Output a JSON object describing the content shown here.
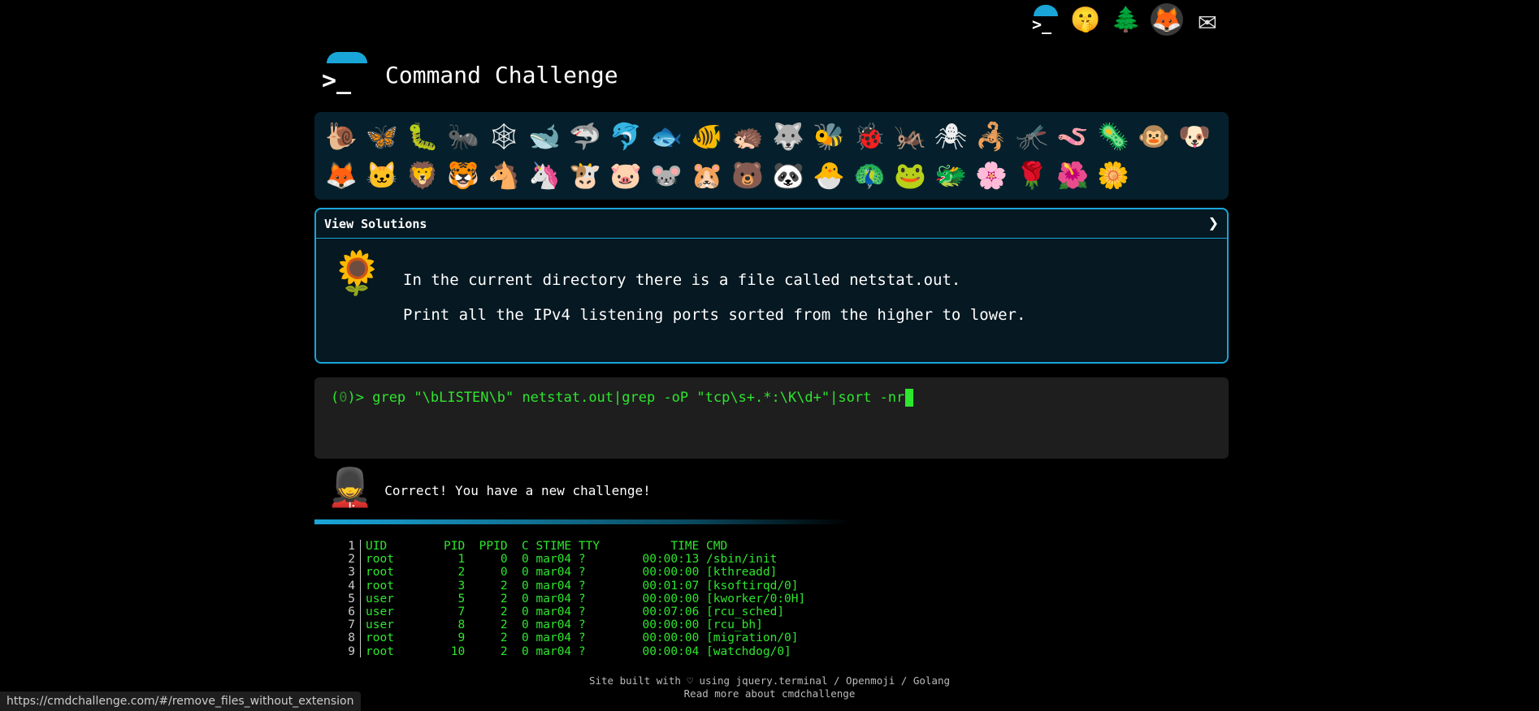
{
  "top_icons": [
    {
      "name": "cmdchallenge-logo-icon",
      "glyph": ""
    },
    {
      "name": "shushing-face-icon",
      "glyph": "🤫"
    },
    {
      "name": "evergreen-tree-icon",
      "glyph": "🌲"
    },
    {
      "name": "gitlab-icon",
      "glyph": "🦊"
    },
    {
      "name": "envelope-icon",
      "glyph": "✉"
    }
  ],
  "header": {
    "prompt_glyph": ">_",
    "title": "Command Challenge"
  },
  "tray": {
    "row1": [
      "🐌",
      "🦋",
      "🐛",
      "🐜",
      "🕸",
      "🐋",
      "🦈",
      "🐬",
      "🐟",
      "🐠",
      "🦔",
      "🐺",
      "🐝",
      "🐞",
      "🦗",
      "🕷",
      "🦂",
      "🦟",
      "🪱",
      "🦠",
      "🐵",
      "🐶"
    ],
    "row2": [
      "🦊",
      "🐱",
      "🦁",
      "🐯",
      "🐴",
      "🦄",
      "🐮",
      "🐷",
      "🐭",
      "🐹",
      "🐻",
      "🐼",
      "🐣",
      "🦚",
      "🐸",
      "🐲",
      "🌸",
      "🌹",
      "🌺",
      "🌼"
    ]
  },
  "panel": {
    "view_solutions": "View Solutions",
    "chevron": "❯",
    "flower": "🌻",
    "line1": "In the current directory there is a file called netstat.out.",
    "line2": "Print all the IPv4 listening ports sorted from the higher to lower."
  },
  "terminal": {
    "prefix_open": "(",
    "counter": "0",
    "prefix_close": ")> ",
    "command": "grep \"\\bLISTEN\\b\" netstat.out|grep -oP \"tcp\\s+.*:\\K\\d+\"|sort -nr"
  },
  "result": {
    "guard": "💂",
    "message": "Correct! You have a new challenge!"
  },
  "listing": [
    {
      "n": "1",
      "text": "UID        PID  PPID  C STIME TTY          TIME CMD"
    },
    {
      "n": "2",
      "text": "root         1     0  0 mar04 ?        00:00:13 /sbin/init"
    },
    {
      "n": "3",
      "text": "root         2     0  0 mar04 ?        00:00:00 [kthreadd]"
    },
    {
      "n": "4",
      "text": "root         3     2  0 mar04 ?        00:01:07 [ksoftirqd/0]"
    },
    {
      "n": "5",
      "text": "user         5     2  0 mar04 ?        00:00:00 [kworker/0:0H]"
    },
    {
      "n": "6",
      "text": "user         7     2  0 mar04 ?        00:07:06 [rcu_sched]"
    },
    {
      "n": "7",
      "text": "user         8     2  0 mar04 ?        00:00:00 [rcu_bh]"
    },
    {
      "n": "8",
      "text": "root         9     2  0 mar04 ?        00:00:00 [migration/0]"
    },
    {
      "n": "9",
      "text": "root        10     2  0 mar04 ?        00:00:04 [watchdog/0]"
    }
  ],
  "footer": {
    "line1": "Site built with ♡ using jquery.terminal / Openmoji / Golang",
    "line2": "Read more about cmdchallenge"
  },
  "statusbar": {
    "url": "https://cmdchallenge.com/#/remove_files_without_extension"
  },
  "colors": {
    "accent": "#1aa5d8",
    "terminal_green": "#2ee62e",
    "background": "#000000",
    "tray_bg": "#05202c"
  }
}
